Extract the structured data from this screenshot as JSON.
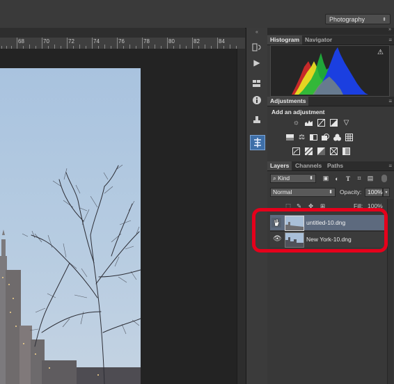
{
  "workspace": {
    "label": "Photography"
  },
  "ruler": {
    "labels": [
      "68",
      "70",
      "72",
      "74",
      "76",
      "78",
      "80",
      "82",
      "84"
    ]
  },
  "panels": {
    "histogram_tab": "Histogram",
    "navigator_tab": "Navigator",
    "adjustments_tab": "Adjustments",
    "adjustments_heading": "Add an adjustment",
    "layers_tab": "Layers",
    "channels_tab": "Channels",
    "paths_tab": "Paths",
    "filter_kind": "Kind",
    "blend_mode": "Normal",
    "opacity_label": "Opacity:",
    "opacity_value": "100%",
    "fill_label": "Fill:",
    "fill_value": "100%"
  },
  "layers": [
    {
      "name": "untitled-10.dng",
      "selected": true
    },
    {
      "name": "New York-10.dng",
      "selected": false
    }
  ],
  "colors": {
    "highlight": "#e5001b",
    "selected_layer": "#5d6a7e"
  }
}
